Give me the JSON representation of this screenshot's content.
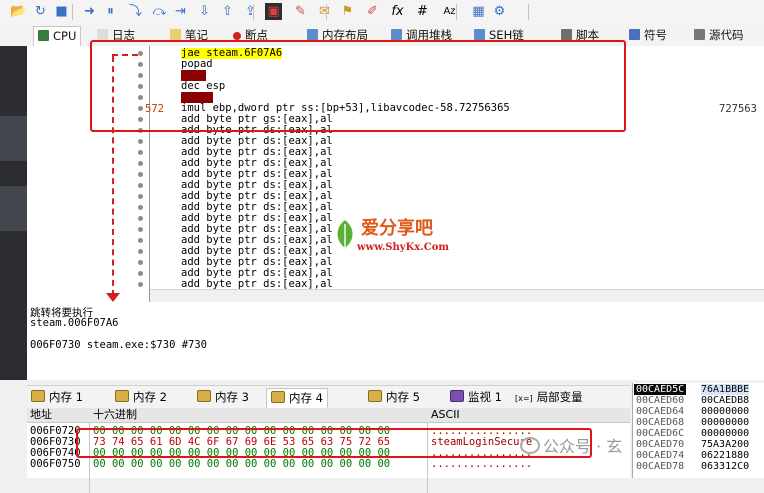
{
  "toolbar": {
    "icons": [
      "open-icon",
      "restart-icon",
      "stop-icon",
      "run-icon",
      "pause-icon",
      "step-into-icon",
      "step-over-icon",
      "step-into-trace-icon",
      "step-over-trace-icon",
      "execute-till-return-icon",
      "run-to-user-code-icon",
      "trace-animate-icon",
      "patch-icon",
      "comment-icon",
      "label-icon",
      "bookmark-icon",
      "function-icon",
      "hash-icon",
      "font-icon",
      "calculator-icon",
      "settings-icon"
    ],
    "fx_label": "fx",
    "hash_label": "#",
    "font_label": "Az"
  },
  "tabs": [
    {
      "label": "CPU",
      "active": true
    },
    {
      "label": "日志"
    },
    {
      "label": "笔记"
    },
    {
      "label": "断点"
    },
    {
      "label": "内存布局"
    },
    {
      "label": "调用堆栈"
    },
    {
      "label": "SEH链"
    },
    {
      "label": "脚本"
    },
    {
      "label": "符号"
    },
    {
      "label": "源代码"
    }
  ],
  "disasm": {
    "addr_fragment": "572",
    "right_fragment": "727563",
    "lines": [
      {
        "text": "jae steam.6F07A6",
        "style": "yellow"
      },
      {
        "text": "popad"
      },
      {
        "text": "insd",
        "style": "red"
      },
      {
        "text": "dec esp"
      },
      {
        "text": "outsd",
        "style": "red"
      },
      {
        "text": "imul ebp,dword ptr ss:[bp+53],libavcodec-58.72756365"
      },
      {
        "text": "add byte ptr gs:[eax],al"
      },
      {
        "text": "add byte ptr ds:[eax],al"
      },
      {
        "text": "add byte ptr ds:[eax],al"
      },
      {
        "text": "add byte ptr ds:[eax],al"
      },
      {
        "text": "add byte ptr ds:[eax],al"
      },
      {
        "text": "add byte ptr ds:[eax],al"
      },
      {
        "text": "add byte ptr ds:[eax],al"
      },
      {
        "text": "add byte ptr ds:[eax],al"
      },
      {
        "text": "add byte ptr ds:[eax],al"
      },
      {
        "text": "add byte ptr ds:[eax],al"
      },
      {
        "text": "add byte ptr ds:[eax],al"
      },
      {
        "text": "add byte ptr ds:[eax],al"
      },
      {
        "text": "add byte ptr ds:[eax],al"
      },
      {
        "text": "add byte ptr ds:[eax],al"
      },
      {
        "text": "add byte ptr ds:[eax],al"
      },
      {
        "text": "add byte ptr ds:[eax],al"
      }
    ]
  },
  "info": {
    "line1": "跳转将要执行",
    "line2": "steam.006F07A6",
    "line3": "006F0730 steam.exe:$730 #730"
  },
  "memory_tabs": [
    {
      "label": "内存 1"
    },
    {
      "label": "内存 2"
    },
    {
      "label": "内存 3"
    },
    {
      "label": "内存 4",
      "active": true
    },
    {
      "label": "内存 5"
    },
    {
      "label": "监视 1"
    },
    {
      "label": "局部变量"
    }
  ],
  "memory_header": {
    "address": "地址",
    "hex": "十六进制",
    "ascii": "ASCII"
  },
  "memory_rows": [
    {
      "address": "006F0720",
      "hex": "00 00 00 00 00 00 00 00 00 00 00 00 00 00 00 00",
      "ascii": "................"
    },
    {
      "address": "006F0730",
      "hex": "73 74 65 61 6D 4C 6F 67 69 6E 53 65 63 75 72 65",
      "ascii": "steamLoginSecure"
    },
    {
      "address": "006F0740",
      "hex": "00 00 00 00 00 00 00 00 00 00 00 00 00 00 00 00",
      "ascii": "................"
    },
    {
      "address": "006F0750",
      "hex": "00 00 00 00 00 00 00 00 00 00 00 00 00 00 00 00",
      "ascii": "................"
    }
  ],
  "stack": [
    {
      "addr": "00CAED5C",
      "value": "76A1BBBE",
      "selected": true
    },
    {
      "addr": "00CAED60",
      "value": "00CAEDB8"
    },
    {
      "addr": "00CAED64",
      "value": "00000000"
    },
    {
      "addr": "00CAED68",
      "value": "00000000"
    },
    {
      "addr": "00CAED6C",
      "value": "00000000"
    },
    {
      "addr": "00CAED70",
      "value": "75A3A200"
    },
    {
      "addr": "00CAED74",
      "value": "06221880"
    },
    {
      "addr": "00CAED78",
      "value": "063312C0"
    }
  ],
  "watermark": {
    "site_name": "爱分享吧",
    "site_url": "www.ShyKx.Com",
    "wechat_text": "公众号 · 玄"
  },
  "colors": {
    "red_annotation": "#e0151b",
    "hex_green": "#007a00",
    "ascii_red": "#a00000",
    "highlight_yellow": "#ffff00"
  }
}
